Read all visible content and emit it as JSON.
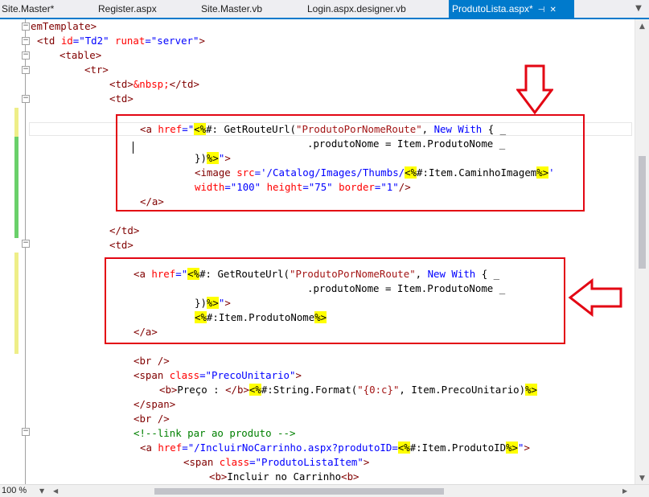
{
  "tabs": [
    {
      "label": "Site.Master*",
      "active": false
    },
    {
      "label": "Register.aspx",
      "active": false
    },
    {
      "label": "Site.Master.vb",
      "active": false
    },
    {
      "label": "Login.aspx.designer.vb",
      "active": false
    },
    {
      "label": "ProdutoLista.aspx*",
      "active": true
    }
  ],
  "icons": {
    "pin": "pin-icon",
    "close": "close-icon",
    "overflow": "tab-overflow-dropdown-icon",
    "fold": "collapse-region-icon",
    "annotation_arrow": "red-outline-arrow-icon"
  },
  "colors": {
    "tag": "#800000",
    "attribute": "#ff0000",
    "attribute_value": "#0000ff",
    "string": "#a31515",
    "keyword": "#0000ff",
    "comment": "#008000",
    "server_delimiter_highlight": "#ffff00",
    "annotation": "#e30613",
    "active_tab": "#007acc"
  },
  "code": {
    "l1": {
      "a": "emTemplate>"
    },
    "l2": {
      "t1": "<td ",
      "a1": "id",
      "e1": "=",
      "v1": "\"Td2\"",
      "sp": " ",
      "a2": "runat",
      "e2": "=",
      "v2": "\"server\"",
      "t2": ">"
    },
    "l3": {
      "t": "<table>"
    },
    "l4": {
      "t": "<tr>"
    },
    "l5": {
      "t1": "<td>",
      "ent": "&nbsp;",
      "t2": "</td>"
    },
    "l6": {
      "t": "<td>"
    },
    "l8": {
      "t1": "<a ",
      "a1": "href",
      "e1": "=",
      "q": "\"",
      "d1": "<%",
      "d2": "#:",
      "f": " GetRouteUrl(",
      "s": "\"ProdutoPorNomeRoute\"",
      "f2": ", ",
      "k": "New With",
      "f3": " { _"
    },
    "l9": {
      "f": ".produtoNome = Item.ProdutoNome _"
    },
    "l10": {
      "f": "})",
      "d": "%>",
      "q": "\"",
      "t": ">"
    },
    "l11": {
      "t1": "<image ",
      "a1": "src",
      "e1": "=",
      "v1": "'/Catalog/Images/Thumbs/",
      "d1": "<%",
      "f": "#:Item.CaminhoImagem",
      "d2": "%>",
      "v2": "'"
    },
    "l12": {
      "a1": "width",
      "e1": "=",
      "v1": "\"100\"",
      "a2": "height",
      "e2": "=",
      "v2": "\"75\"",
      "a3": "border",
      "e3": "=",
      "v3": "\"1\"",
      "t": "/>"
    },
    "l13": {
      "t": "</a>"
    },
    "l15": {
      "t": "</td>"
    },
    "l16": {
      "t": "<td>"
    },
    "l18": {
      "t1": "<a ",
      "a1": "href",
      "e1": "=",
      "q": "\"",
      "d1": "<%",
      "d2": "#:",
      "f": " GetRouteUrl(",
      "s": "\"ProdutoPorNomeRoute\"",
      "f2": ", ",
      "k": "New With",
      "f3": " { _"
    },
    "l19": {
      "f": ".produtoNome = Item.ProdutoNome _"
    },
    "l20": {
      "f": "})",
      "d": "%>",
      "q": "\"",
      "t": ">"
    },
    "l21": {
      "d1": "<%",
      "f": "#:Item.ProdutoNome",
      "d2": "%>"
    },
    "l22": {
      "t": "</a>"
    },
    "l24": {
      "t": "<br />"
    },
    "l25": {
      "t1": "<span ",
      "a1": "class",
      "e1": "=",
      "v1": "\"PrecoUnitario\"",
      "t2": ">"
    },
    "l26": {
      "t1": "<b>",
      "txt": "Preço : ",
      "t2": "</b>",
      "d1": "<%",
      "f": "#:String.Format(",
      "s": "\"{0:c}\"",
      "f2": ", Item.PrecoUnitario)",
      "d2": "%>"
    },
    "l27": {
      "t": "</span>"
    },
    "l28": {
      "t": "<br />"
    },
    "l29": {
      "c": "<!--link par ao produto -->"
    },
    "l30": {
      "t1": "<a ",
      "a1": "href",
      "e1": "=",
      "v1": "\"/IncluirNoCarrinho.aspx?produtoID=",
      "d1": "<%",
      "f": "#:Item.ProdutoID",
      "d2": "%>",
      "v2": "\"",
      "t2": ">"
    },
    "l31": {
      "t1": "<span ",
      "a1": "class",
      "e1": "=",
      "v1": "\"ProdutoListaItem\"",
      "t2": ">"
    },
    "l32": {
      "t1": "<b>",
      "txt": "Incluir no Carrinho",
      "t2": "<b>"
    }
  },
  "status": {
    "zoom": "100 %"
  }
}
